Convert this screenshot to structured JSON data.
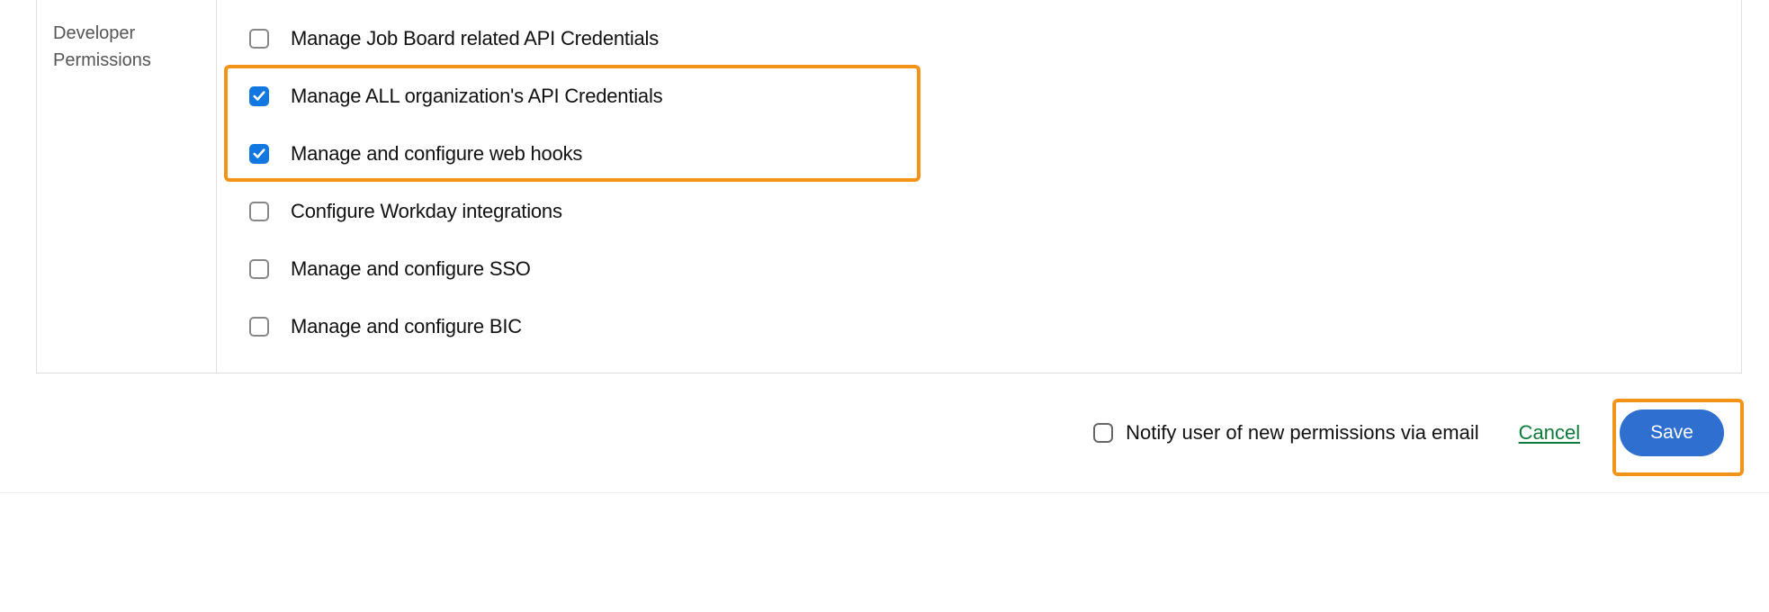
{
  "section": {
    "label_line1": "Developer",
    "label_line2": "Permissions"
  },
  "permissions": [
    {
      "id": "job-board-api",
      "label": "Manage Job Board related API Credentials",
      "checked": false
    },
    {
      "id": "all-api",
      "label": "Manage ALL organization's API Credentials",
      "checked": true
    },
    {
      "id": "web-hooks",
      "label": "Manage and configure web hooks",
      "checked": true
    },
    {
      "id": "workday",
      "label": "Configure Workday integrations",
      "checked": false
    },
    {
      "id": "sso",
      "label": "Manage and configure SSO",
      "checked": false
    },
    {
      "id": "bic",
      "label": "Manage and configure BIC",
      "checked": false
    }
  ],
  "footer": {
    "notify_label": "Notify user of new permissions via email",
    "notify_checked": false,
    "cancel_label": "Cancel",
    "save_label": "Save"
  }
}
